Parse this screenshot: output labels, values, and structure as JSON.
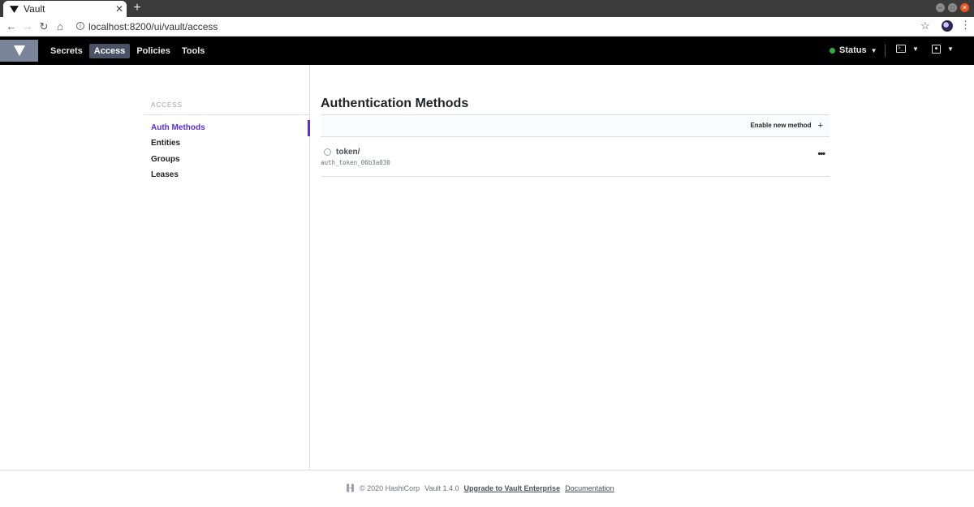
{
  "browser": {
    "tab_title": "Vault",
    "url": "localhost:8200/ui/vault/access"
  },
  "nav": {
    "links": [
      "Secrets",
      "Access",
      "Policies",
      "Tools"
    ],
    "active": "Access",
    "status_label": "Status",
    "status_color": "#2eb039"
  },
  "sidebar": {
    "heading": "ACCESS",
    "items": [
      "Auth Methods",
      "Entities",
      "Groups",
      "Leases"
    ],
    "active": "Auth Methods"
  },
  "main": {
    "title": "Authentication Methods",
    "enable_button": "Enable new method",
    "methods": [
      {
        "path": "token/",
        "accessor": "auth_token_06b3a030"
      }
    ]
  },
  "footer": {
    "copyright": "© 2020 HashiCorp",
    "version": "Vault 1.4.0",
    "upgrade_link": "Upgrade to Vault Enterprise",
    "docs_link": "Documentation"
  },
  "colors": {
    "accent": "#5b2ddb",
    "nav_bg": "#000000"
  }
}
